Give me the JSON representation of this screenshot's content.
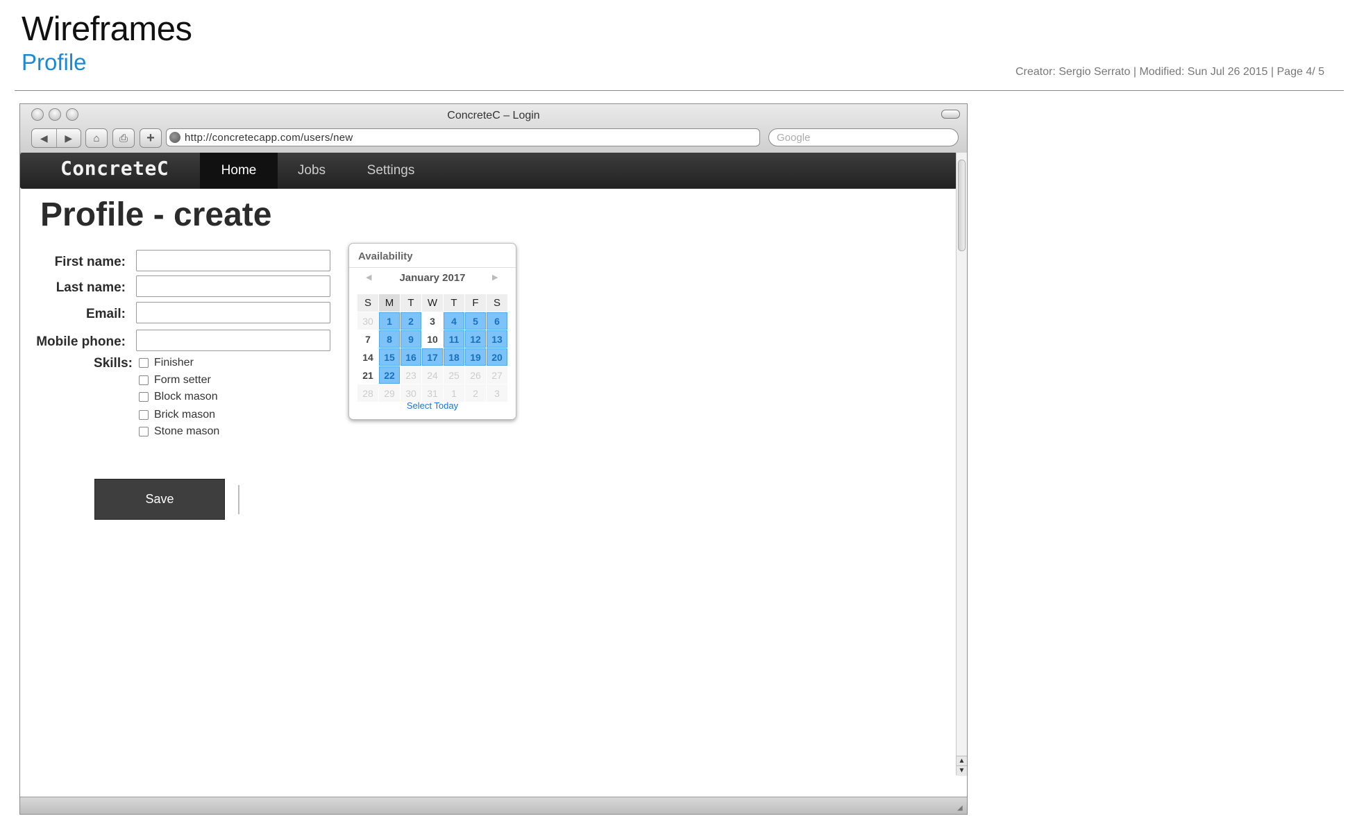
{
  "doc": {
    "title": "Wireframes",
    "subtitle": "Profile",
    "meta": "Creator: Sergio Serrato  |  Modified: Sun Jul 26 2015  |  Page 4/ 5"
  },
  "browser": {
    "window_title": "ConcreteC – Login",
    "url": "http://concretecapp.com/users/new",
    "search_placeholder": "Google",
    "back_icon": "◀",
    "forward_icon": "▶",
    "home_icon": "⌂",
    "print_icon": "⎙",
    "add_icon": "+"
  },
  "app": {
    "brand": "ConcreteC",
    "nav": [
      {
        "label": "Home",
        "active": true
      },
      {
        "label": "Jobs",
        "active": false
      },
      {
        "label": "Settings",
        "active": false
      }
    ]
  },
  "form": {
    "heading": "Profile - create",
    "first_name_label": "First name:",
    "last_name_label": "Last name:",
    "email_label": "Email:",
    "mobile_label": "Mobile phone:",
    "first_name_value": "",
    "last_name_value": "",
    "email_value": "",
    "mobile_value": "",
    "skills_label": "Skills:",
    "skills": [
      {
        "label": "Finisher",
        "checked": false
      },
      {
        "label": "Form setter",
        "checked": false
      },
      {
        "label": "Block mason",
        "checked": false
      },
      {
        "label": "Brick mason",
        "checked": false
      },
      {
        "label": "Stone mason",
        "checked": false
      }
    ],
    "save_label": "Save"
  },
  "calendar": {
    "title": "Availability",
    "month": "January 2017",
    "prev_icon": "◀",
    "next_icon": "▶",
    "weekdays": [
      "S",
      "M",
      "T",
      "W",
      "T",
      "F",
      "S"
    ],
    "weeks": [
      [
        {
          "d": "30",
          "s": "dim"
        },
        {
          "d": "1",
          "s": "sel"
        },
        {
          "d": "2",
          "s": "sel"
        },
        {
          "d": "3",
          "s": "plain"
        },
        {
          "d": "4",
          "s": "sel"
        },
        {
          "d": "5",
          "s": "sel"
        },
        {
          "d": "6",
          "s": "sel"
        }
      ],
      [
        {
          "d": "7",
          "s": "plain"
        },
        {
          "d": "8",
          "s": "sel"
        },
        {
          "d": "9",
          "s": "sel"
        },
        {
          "d": "10",
          "s": "plain"
        },
        {
          "d": "11",
          "s": "sel"
        },
        {
          "d": "12",
          "s": "sel"
        },
        {
          "d": "13",
          "s": "sel"
        }
      ],
      [
        {
          "d": "14",
          "s": "plain"
        },
        {
          "d": "15",
          "s": "sel"
        },
        {
          "d": "16",
          "s": "sel"
        },
        {
          "d": "17",
          "s": "sel"
        },
        {
          "d": "18",
          "s": "sel"
        },
        {
          "d": "19",
          "s": "sel"
        },
        {
          "d": "20",
          "s": "sel"
        }
      ],
      [
        {
          "d": "21",
          "s": "plain"
        },
        {
          "d": "22",
          "s": "sel"
        },
        {
          "d": "23",
          "s": "dim"
        },
        {
          "d": "24",
          "s": "dim"
        },
        {
          "d": "25",
          "s": "dim"
        },
        {
          "d": "26",
          "s": "dim"
        },
        {
          "d": "27",
          "s": "dim"
        }
      ],
      [
        {
          "d": "28",
          "s": "dim"
        },
        {
          "d": "29",
          "s": "dim"
        },
        {
          "d": "30",
          "s": "dim"
        },
        {
          "d": "31",
          "s": "dim"
        },
        {
          "d": "1",
          "s": "dim"
        },
        {
          "d": "2",
          "s": "dim"
        },
        {
          "d": "3",
          "s": "dim"
        }
      ]
    ],
    "select_today_label": "Select Today"
  },
  "colors": {
    "accent": "#1a8ad6",
    "selected_day": "#7dc3f7",
    "navbar": "#2a2a2a"
  }
}
